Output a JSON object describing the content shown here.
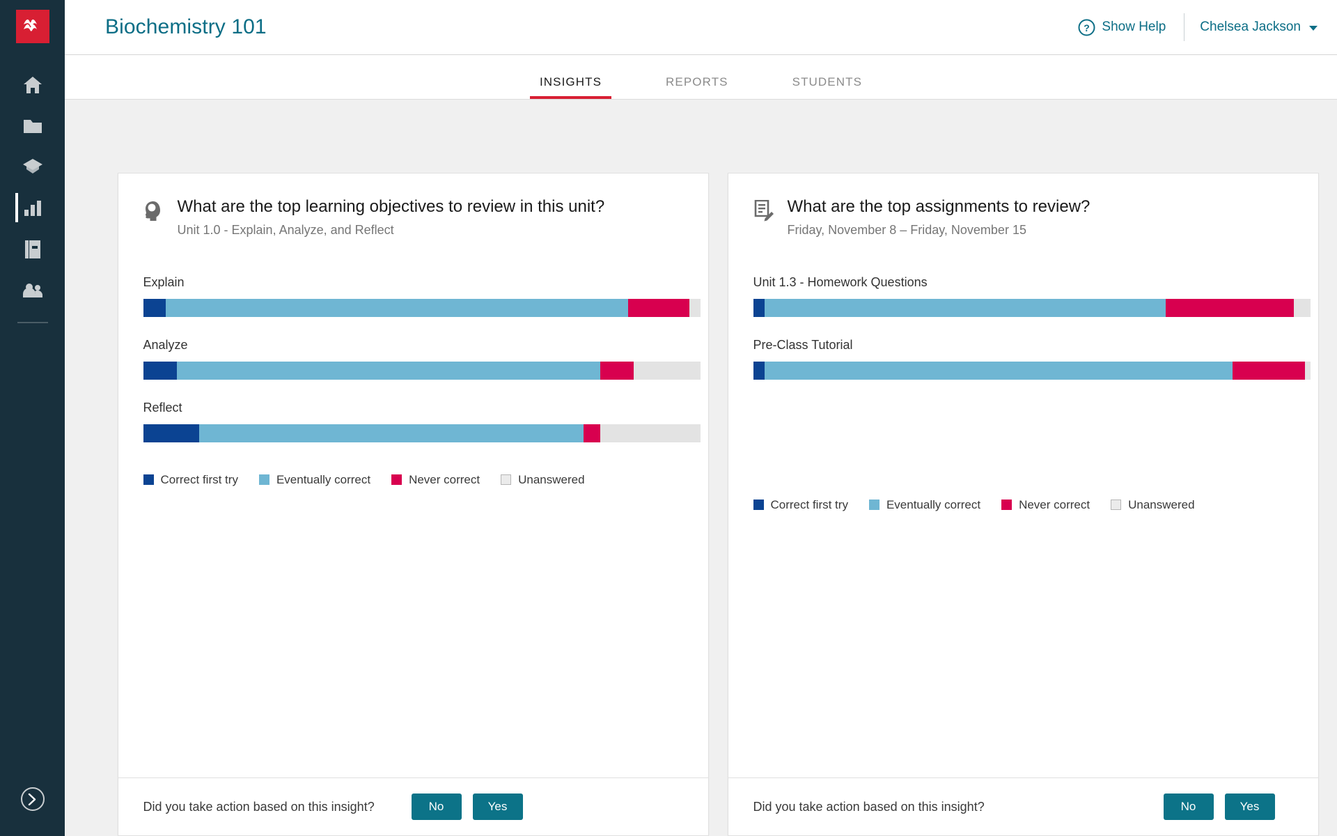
{
  "sidebar": {
    "logo_name": "macmillan-logo",
    "items": [
      {
        "icon": "home-icon",
        "name": "home"
      },
      {
        "icon": "folder-icon",
        "name": "resources"
      },
      {
        "icon": "graduation-cap-icon",
        "name": "gradebook"
      },
      {
        "icon": "bar-chart-icon",
        "name": "insights",
        "active": true
      },
      {
        "icon": "book-icon",
        "name": "ebook"
      },
      {
        "icon": "people-icon",
        "name": "class"
      }
    ],
    "expand_icon": "chevron-right-circle-icon"
  },
  "header": {
    "course_title": "Biochemistry 101",
    "help_label": "Show Help",
    "help_icon": "question-circle-icon",
    "user_name": "Chelsea Jackson",
    "user_caret_icon": "caret-down-icon"
  },
  "tabs": [
    {
      "label": "INSIGHTS",
      "active": true
    },
    {
      "label": "REPORTS",
      "active": false
    },
    {
      "label": "STUDENTS",
      "active": false
    }
  ],
  "colors": {
    "accent_teal": "#0c6e86",
    "brand_red": "#d81f33",
    "sidebar_bg": "#18303d",
    "correct_first_try": "#0b4392",
    "eventually_correct": "#6fb6d3",
    "never_correct": "#d8004f",
    "unanswered": "#e3e3e3"
  },
  "legend": [
    {
      "label": "Correct first try",
      "key": "correct"
    },
    {
      "label": "Eventually correct",
      "key": "eventual"
    },
    {
      "label": "Never correct",
      "key": "never"
    },
    {
      "label": "Unanswered",
      "key": "unanswered"
    }
  ],
  "footer_prompt": "Did you take action based on this insight?",
  "footer_no": "No",
  "footer_yes": "Yes",
  "cards": [
    {
      "icon": "head-idea-icon",
      "title": "What are the top learning objectives to review in this unit?",
      "subtitle": "Unit 1.0 - Explain, Analyze, and Reflect"
    },
    {
      "icon": "document-edit-icon",
      "title": "What are the top assignments to review?",
      "subtitle": "Friday, November 8 – Friday, November 15"
    }
  ],
  "chart_data": [
    {
      "type": "bar",
      "title": "What are the top learning objectives to review in this unit?",
      "subtitle": "Unit 1.0 - Explain, Analyze, and Reflect",
      "stacked": true,
      "orientation": "horizontal",
      "units": "percent",
      "xlim": [
        0,
        100
      ],
      "grid": false,
      "legend_position": "bottom",
      "categories": [
        "Explain",
        "Analyze",
        "Reflect"
      ],
      "series": [
        {
          "name": "Correct first try",
          "color": "#0b4392",
          "values": [
            4,
            6,
            10
          ]
        },
        {
          "name": "Eventually correct",
          "color": "#6fb6d3",
          "values": [
            83,
            76,
            69
          ]
        },
        {
          "name": "Never correct",
          "color": "#d8004f",
          "values": [
            11,
            6,
            3
          ]
        },
        {
          "name": "Unanswered",
          "color": "#e3e3e3",
          "values": [
            2,
            12,
            18
          ]
        }
      ]
    },
    {
      "type": "bar",
      "title": "What are the top assignments to review?",
      "subtitle": "Friday, November 8 – Friday, November 15",
      "stacked": true,
      "orientation": "horizontal",
      "units": "percent",
      "xlim": [
        0,
        100
      ],
      "grid": false,
      "legend_position": "bottom",
      "categories": [
        "Unit 1.3 - Homework Questions",
        "Pre-Class Tutorial"
      ],
      "series": [
        {
          "name": "Correct first try",
          "color": "#0b4392",
          "values": [
            2,
            2
          ]
        },
        {
          "name": "Eventually correct",
          "color": "#6fb6d3",
          "values": [
            72,
            84
          ]
        },
        {
          "name": "Never correct",
          "color": "#d8004f",
          "values": [
            23,
            13
          ]
        },
        {
          "name": "Unanswered",
          "color": "#e3e3e3",
          "values": [
            3,
            1
          ]
        }
      ]
    }
  ]
}
